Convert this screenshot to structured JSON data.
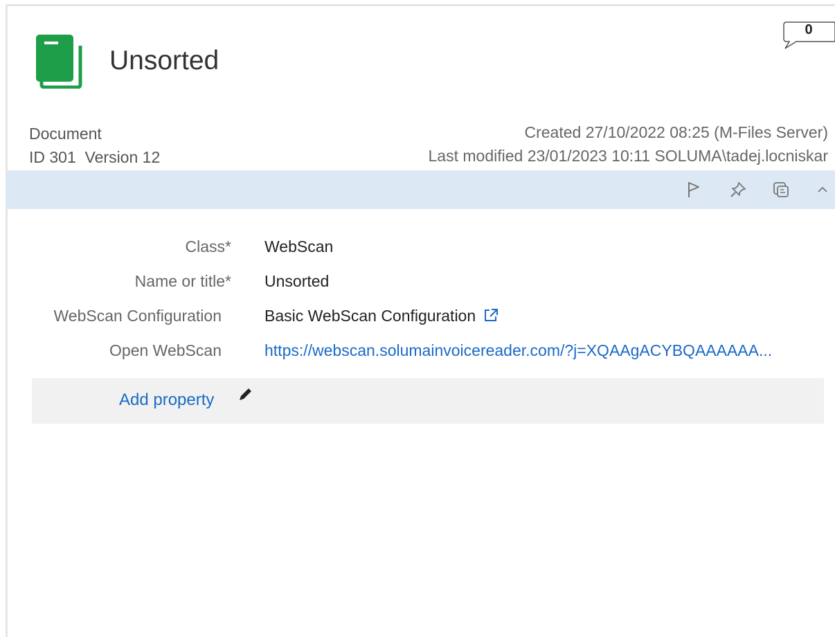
{
  "object": {
    "title": "Unsorted",
    "comment_count": "0",
    "type": "Document",
    "id_version": "ID 301  Version 12",
    "created": "Created 27/10/2022 08:25 (M-Files Server)",
    "last_modified": "Last modified 23/01/2023 10:11 SOLUMA\\tadej.locniskar"
  },
  "colors": {
    "accent_green": "#1f9e4a",
    "link_blue": "#1a6ac6",
    "toolbar_bg": "#dce9f4"
  },
  "toolbar": {
    "icons": [
      "flag-icon",
      "pin-icon",
      "duplicate-icon",
      "chevron-up-icon"
    ]
  },
  "properties": [
    {
      "label": "Class",
      "value": "WebScan",
      "required": true
    },
    {
      "label": "Name or title",
      "value": "Unsorted",
      "required": true
    },
    {
      "label": "WebScan Configuration",
      "value": "Basic WebScan Configuration",
      "required": false
    },
    {
      "label": "Open WebScan",
      "value": "https://webscan.solumainvoicereader.com/?j=XQAAgACYBQAAAAAA...",
      "required": false
    }
  ],
  "add_property_label": "Add property",
  "required_marker": "*"
}
